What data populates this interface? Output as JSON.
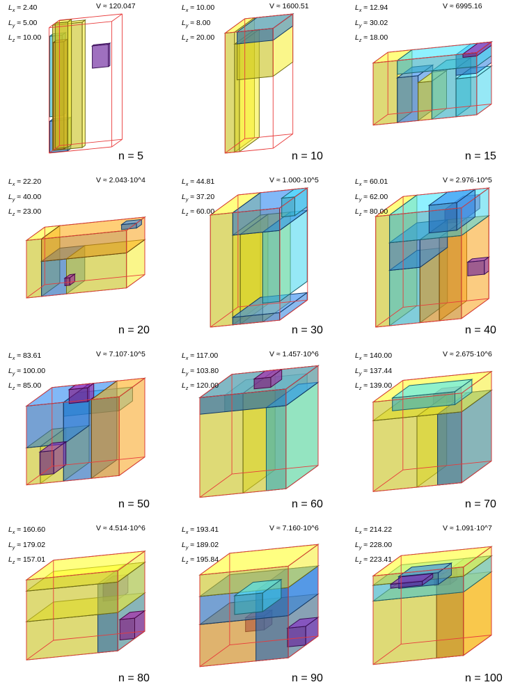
{
  "colors": {
    "yellow": "#f5ee2a",
    "orange": "#f7a21a",
    "cyan": "#3fd6ee",
    "blue": "#2a7fe0",
    "purple": "#7a1fb8",
    "magenta": "#a0109a",
    "frame": "#e83a3a"
  },
  "panels": [
    {
      "lx": "≈ 2.40",
      "ly": "≈ 5.00",
      "lz": "≈ 10.00",
      "v": "V ≈ 120.047",
      "n": "n = 5",
      "frame": [
        3.5,
        7,
        14
      ],
      "boxes": [
        [
          0.2,
          0,
          0,
          1.2,
          1.4,
          14,
          "yellow"
        ],
        [
          1.3,
          0,
          0,
          1.0,
          3.3,
          14,
          "yellow"
        ],
        [
          2.2,
          0,
          4,
          1.1,
          1.4,
          9,
          "cyan"
        ],
        [
          2.2,
          0,
          0,
          1.1,
          2.0,
          3.5,
          "blue"
        ],
        [
          1.1,
          4.2,
          8.6,
          0.5,
          1.8,
          2.5,
          "purple"
        ],
        [
          1.1,
          0,
          0,
          1.0,
          1.2,
          12,
          "orange"
        ]
      ]
    },
    {
      "lx": "≈ 10.00",
      "ly": "≈ 8.00",
      "lz": "≈ 20.00",
      "v": "V ≈ 1600.51",
      "n": "n = 10",
      "frame": [
        10,
        8,
        20
      ],
      "boxes": [
        [
          0,
          0,
          0,
          10,
          1.6,
          20,
          "yellow"
        ],
        [
          0,
          2,
          12,
          10,
          6,
          8,
          "yellow"
        ],
        [
          0,
          2,
          18,
          10,
          6,
          2,
          "blue"
        ],
        [
          0,
          1.6,
          0,
          10,
          0.8,
          18,
          "yellow"
        ]
      ]
    },
    {
      "lx": "≈ 12.94",
      "ly": "≈ 30.02",
      "lz": "≈ 18.00",
      "v": "V ≈ 6995.16",
      "n": "n = 15",
      "frame": [
        12.94,
        30,
        18
      ],
      "boxes": [
        [
          0,
          0,
          0,
          12.9,
          7,
          18,
          "yellow"
        ],
        [
          0,
          7,
          14,
          12.9,
          23,
          4,
          "cyan"
        ],
        [
          0,
          7,
          0,
          12.9,
          6,
          13,
          "blue"
        ],
        [
          0,
          13,
          0,
          12.9,
          4,
          11,
          "yellow"
        ],
        [
          0,
          17,
          0,
          12.9,
          7,
          14,
          "cyan"
        ],
        [
          0,
          24,
          12,
          12.9,
          6,
          6,
          "blue"
        ],
        [
          0,
          24,
          0,
          12.9,
          6,
          11,
          "cyan"
        ],
        [
          0,
          26,
          17,
          12.9,
          4,
          1,
          "magenta"
        ]
      ]
    },
    {
      "lx": "≈ 22.20",
      "ly": "≈ 40.00",
      "lz": "≈ 23.00",
      "v": "V ≈ 2.043·10^4",
      "n": "n = 20",
      "frame": [
        22.2,
        40,
        23
      ],
      "boxes": [
        [
          0,
          0,
          0,
          22.2,
          6,
          23,
          "yellow"
        ],
        [
          0,
          6,
          14,
          22.2,
          34,
          9,
          "orange"
        ],
        [
          0,
          6,
          0,
          22.2,
          10,
          14,
          "blue"
        ],
        [
          0,
          16,
          0,
          22.2,
          24,
          14,
          "yellow"
        ],
        [
          4,
          34,
          21,
          6,
          6,
          2,
          "blue"
        ],
        [
          0,
          10,
          0,
          6,
          2,
          3,
          "magenta"
        ]
      ]
    },
    {
      "lx": "≈ 44.81",
      "ly": "≈ 37.20",
      "lz": "≈ 60.00",
      "v": "V ≈ 1.000·10^5",
      "n": "n = 30",
      "frame": [
        44.8,
        37.2,
        60
      ],
      "boxes": [
        [
          0,
          0,
          0,
          44.8,
          12,
          60,
          "yellow"
        ],
        [
          0,
          12,
          48,
          44.8,
          25,
          12,
          "blue"
        ],
        [
          0,
          12,
          0,
          44.8,
          4,
          48,
          "yellow"
        ],
        [
          0,
          16,
          0,
          44.8,
          12,
          48,
          "yellow"
        ],
        [
          0,
          28,
          10,
          44.8,
          9,
          38,
          "cyan"
        ],
        [
          0,
          12,
          0,
          44.8,
          25,
          4,
          "blue"
        ],
        [
          0,
          30,
          50,
          20,
          7,
          10,
          "cyan"
        ]
      ]
    },
    {
      "lx": "≈ 60.01",
      "ly": "≈ 62.00",
      "lz": "≈ 80.00",
      "v": "V ≈ 2.976·10^5",
      "n": "n = 40",
      "frame": [
        60,
        62,
        80
      ],
      "boxes": [
        [
          0,
          0,
          0,
          60,
          10,
          80,
          "yellow"
        ],
        [
          0,
          10,
          60,
          60,
          52,
          20,
          "cyan"
        ],
        [
          0,
          10,
          0,
          60,
          22,
          40,
          "cyan"
        ],
        [
          0,
          10,
          40,
          60,
          22,
          20,
          "blue"
        ],
        [
          0,
          32,
          0,
          60,
          14,
          60,
          "orange"
        ],
        [
          0,
          46,
          0,
          60,
          16,
          60,
          "orange"
        ],
        [
          0,
          32,
          60,
          40,
          20,
          20,
          "blue"
        ],
        [
          20,
          50,
          70,
          40,
          12,
          10,
          "purple"
        ],
        [
          0,
          50,
          20,
          10,
          12,
          10,
          "purple"
        ]
      ]
    },
    {
      "lx": "≈ 83.61",
      "ly": "≈ 100.00",
      "lz": "≈ 85.00",
      "v": "V ≈ 7.107·10^5",
      "n": "n = 50",
      "frame": [
        83.6,
        100,
        85
      ],
      "boxes": [
        [
          0,
          0,
          40,
          83.6,
          40,
          45,
          "blue"
        ],
        [
          0,
          0,
          0,
          83.6,
          15,
          40,
          "yellow"
        ],
        [
          0,
          15,
          0,
          83.6,
          25,
          40,
          "yellow"
        ],
        [
          0,
          40,
          0,
          83.6,
          30,
          85,
          "blue"
        ],
        [
          0,
          70,
          0,
          83.6,
          30,
          85,
          "orange"
        ],
        [
          40,
          40,
          70,
          43.6,
          60,
          15,
          "cyan"
        ],
        [
          0,
          0,
          0,
          40,
          15,
          25,
          "purple"
        ],
        [
          0,
          25,
          70,
          20,
          20,
          15,
          "magenta"
        ]
      ]
    },
    {
      "lx": "≈ 117.00",
      "ly": "≈ 103.80",
      "lz": "≈ 120.00",
      "v": "V ≈ 1.457·10^6",
      "n": "n = 60",
      "frame": [
        117,
        103.8,
        120
      ],
      "boxes": [
        [
          0,
          0,
          0,
          117,
          52,
          120,
          "yellow"
        ],
        [
          0,
          52,
          0,
          117,
          51.8,
          120,
          "yellow"
        ],
        [
          0,
          0,
          100,
          117,
          103.8,
          20,
          "blue"
        ],
        [
          40,
          30,
          100,
          77,
          73.8,
          20,
          "cyan"
        ],
        [
          0,
          40,
          108,
          40,
          20,
          12,
          "magenta"
        ],
        [
          0,
          80,
          0,
          117,
          23.8,
          100,
          "cyan"
        ]
      ]
    },
    {
      "lx": "≈ 140.00",
      "ly": "≈ 137.44",
      "lz": "≈ 139.00",
      "v": "V ≈ 2.675·10^6",
      "n": "n = 70",
      "frame": [
        140,
        137.4,
        139
      ],
      "boxes": [
        [
          0,
          0,
          0,
          140,
          68,
          110,
          "yellow"
        ],
        [
          0,
          68,
          0,
          140,
          69.4,
          110,
          "yellow"
        ],
        [
          0,
          0,
          110,
          140,
          137.4,
          29,
          "yellow"
        ],
        [
          30,
          20,
          116,
          80,
          97,
          20,
          "cyan"
        ],
        [
          0,
          100,
          0,
          140,
          37.4,
          110,
          "blue"
        ],
        [
          90,
          90,
          125,
          40,
          30,
          14,
          "magenta"
        ]
      ]
    },
    {
      "lx": "≈ 160.60",
      "ly": "≈ 179.02",
      "lz": "≈ 157.01",
      "v": "V ≈ 4.514·10^6",
      "n": "n = 80",
      "frame": [
        160.6,
        179,
        157
      ],
      "boxes": [
        [
          0,
          0,
          0,
          160.6,
          179,
          75,
          "yellow"
        ],
        [
          0,
          0,
          75,
          160.6,
          179,
          60,
          "yellow"
        ],
        [
          0,
          0,
          135,
          160.6,
          179,
          22,
          "yellow"
        ],
        [
          0,
          140,
          0,
          160.6,
          39,
          135,
          "blue"
        ],
        [
          0,
          150,
          0,
          60,
          29,
          40,
          "magenta"
        ],
        [
          100,
          150,
          100,
          60,
          29,
          35,
          "purple"
        ]
      ]
    },
    {
      "lx": "≈ 193.41",
      "ly": "≈ 189.02",
      "lz": "≈ 195.84",
      "v": "V ≈ 7.160·10^6",
      "n": "n = 90",
      "frame": [
        193.4,
        189,
        195.8
      ],
      "boxes": [
        [
          0,
          0,
          0,
          193.4,
          189,
          90,
          "orange"
        ],
        [
          0,
          0,
          90,
          193.4,
          189,
          60,
          "blue"
        ],
        [
          0,
          0,
          150,
          193.4,
          189,
          45.8,
          "yellow"
        ],
        [
          0,
          120,
          0,
          193.4,
          69,
          150,
          "blue"
        ],
        [
          30,
          60,
          95,
          120,
          60,
          40,
          "cyan"
        ],
        [
          0,
          150,
          0,
          80,
          39,
          40,
          "purple"
        ],
        [
          120,
          90,
          60,
          50,
          40,
          30,
          "magenta"
        ]
      ]
    },
    {
      "lx": "≈ 214.22",
      "ly": "≈ 228.00",
      "lz": "≈ 223.41",
      "v": "V ≈ 1.091·10^7",
      "n": "n = 100",
      "frame": [
        214.2,
        228,
        223.4
      ],
      "boxes": [
        [
          0,
          0,
          0,
          214.2,
          228,
          160,
          "yellow"
        ],
        [
          0,
          0,
          160,
          214.2,
          228,
          40,
          "cyan"
        ],
        [
          0,
          0,
          200,
          214.2,
          228,
          23.4,
          "yellow"
        ],
        [
          0,
          160,
          0,
          214.2,
          68,
          200,
          "orange"
        ],
        [
          40,
          40,
          170,
          100,
          100,
          30,
          "blue"
        ],
        [
          150,
          150,
          180,
          50,
          40,
          30,
          "magenta"
        ],
        [
          0,
          0,
          160,
          80,
          80,
          10,
          "purple"
        ]
      ]
    }
  ]
}
